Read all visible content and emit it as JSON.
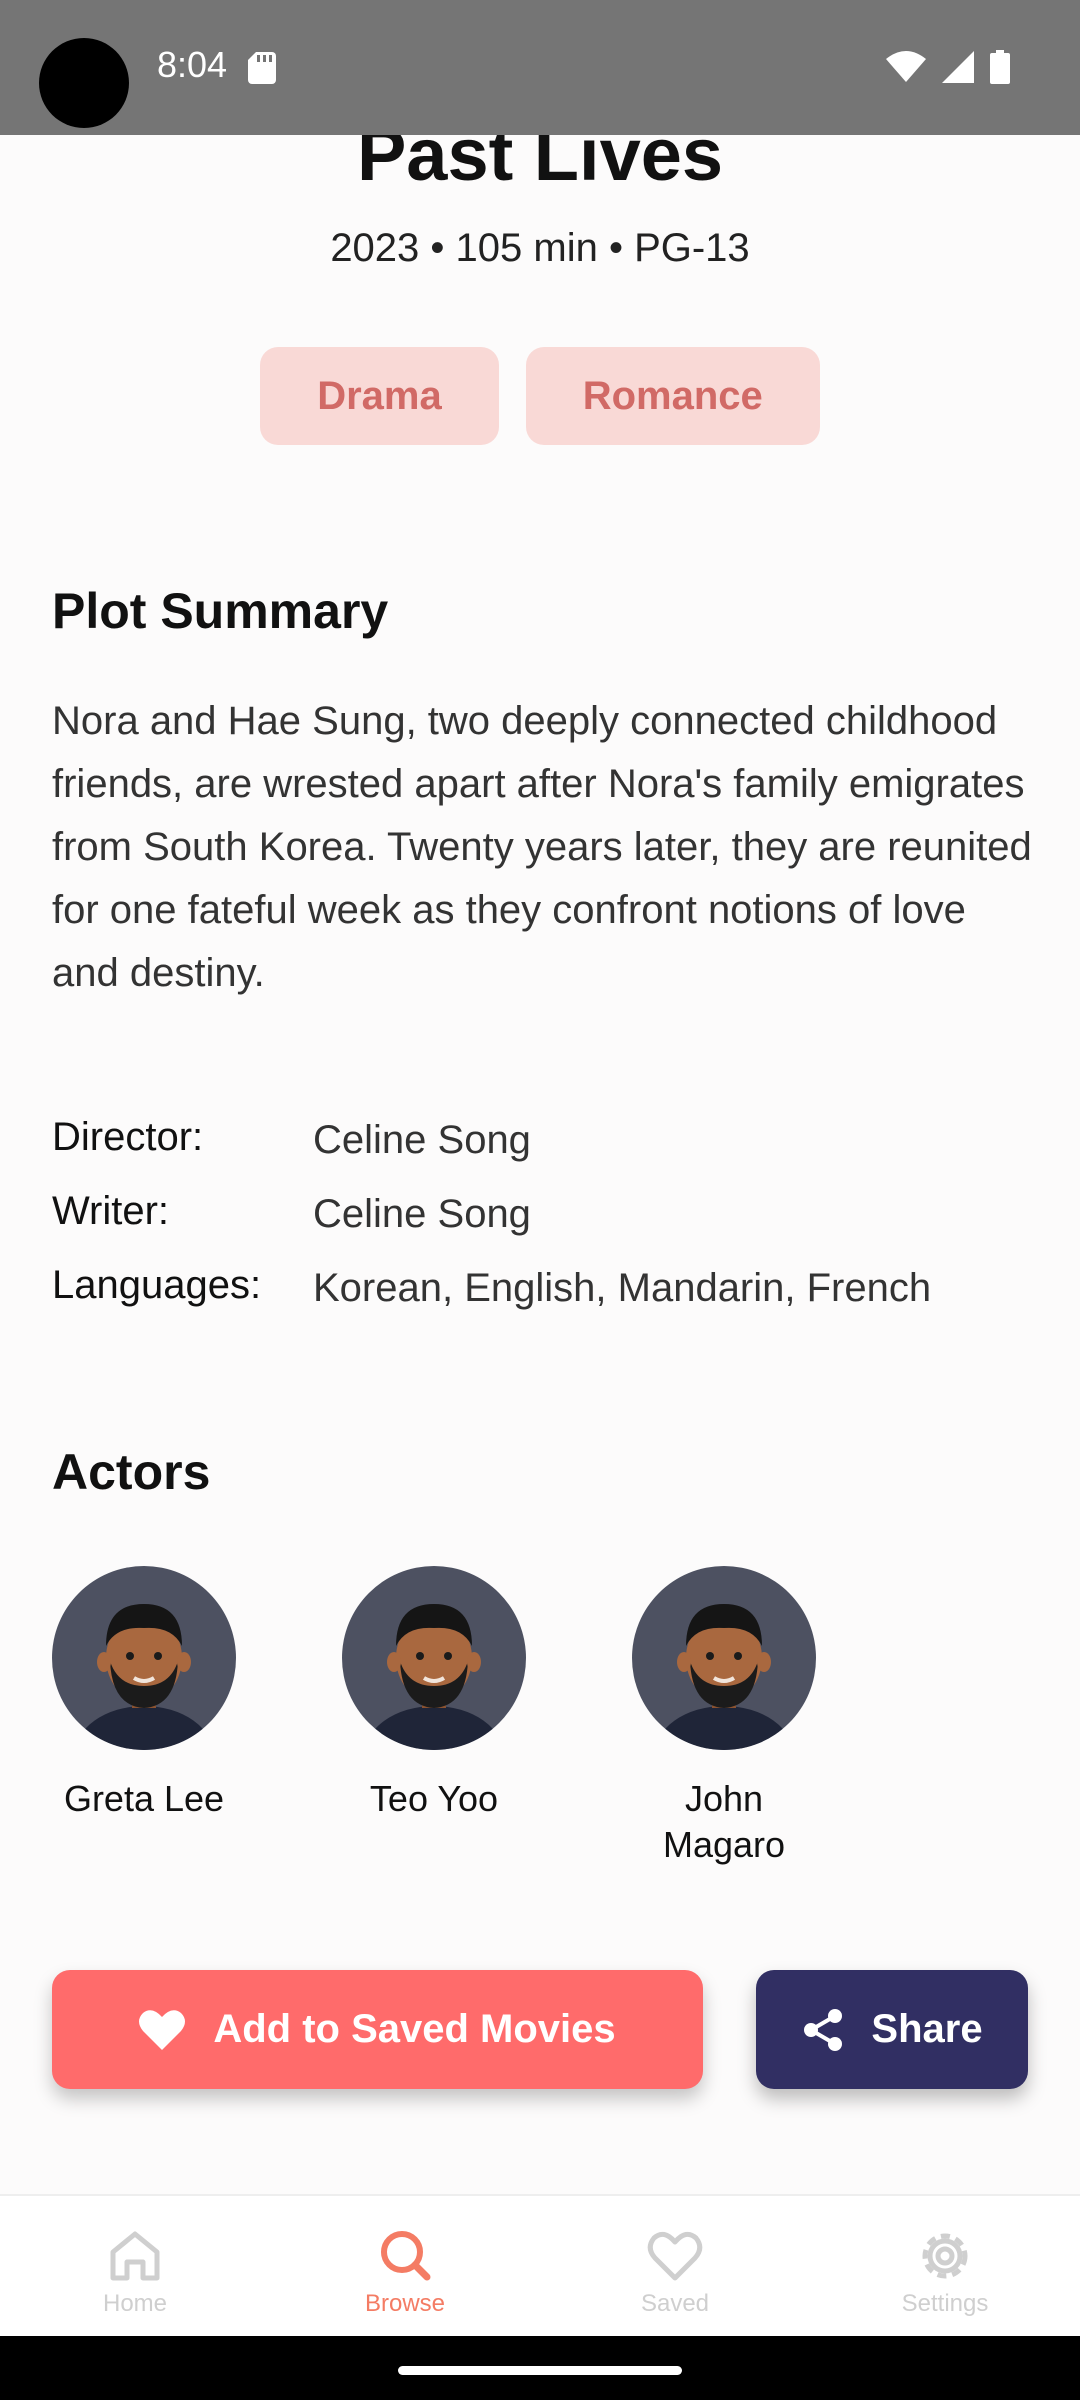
{
  "status": {
    "time": "8:04"
  },
  "movie": {
    "title": "Past Lives",
    "meta": "2023 • 105 min • PG-13",
    "genres": [
      "Drama",
      "Romance"
    ]
  },
  "plot": {
    "heading": "Plot Summary",
    "text": "Nora and Hae Sung, two deeply connected childhood friends, are wrested apart after Nora's family emigrates from South Korea. Twenty years later, they are reunited for one fateful week as they confront notions of love and destiny."
  },
  "credits": [
    {
      "label": "Director:",
      "value": "Celine Song"
    },
    {
      "label": "Writer:",
      "value": "Celine Song"
    },
    {
      "label": "Languages:",
      "value": "Korean, English, Mandarin, French"
    }
  ],
  "actors": {
    "heading": "Actors",
    "list": [
      {
        "name": "Greta Lee"
      },
      {
        "name": "Teo Yoo"
      },
      {
        "name": "John Magaro"
      }
    ]
  },
  "actions": {
    "save_label": "Add to Saved Movies",
    "share_label": "Share"
  },
  "nav": [
    {
      "label": "Home",
      "icon": "home-icon",
      "active": false
    },
    {
      "label": "Browse",
      "icon": "search-icon",
      "active": true
    },
    {
      "label": "Saved",
      "icon": "heart-icon",
      "active": false
    },
    {
      "label": "Settings",
      "icon": "gear-icon",
      "active": false
    }
  ],
  "colors": {
    "accent": "#ff6b6b",
    "chip_bg": "#f9d9d6",
    "chip_text": "#d16a66",
    "share_bg": "#312f63",
    "nav_active": "#f47c64",
    "nav_inactive": "#cfcfcf"
  }
}
